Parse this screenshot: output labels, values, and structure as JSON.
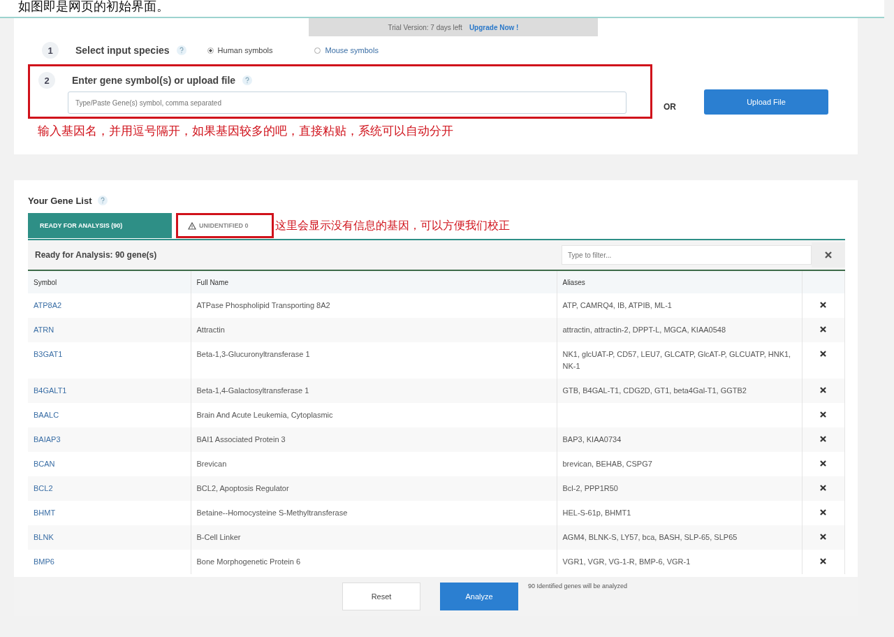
{
  "caption": "如图即是网页的初始界面。",
  "trial_banner": {
    "text": "Trial Version: 7 days left",
    "link": "Upgrade Now !"
  },
  "step1": {
    "number": "1",
    "label": "Select input species",
    "options": [
      {
        "label": "Human symbols",
        "selected": true
      },
      {
        "label": "Mouse symbols",
        "selected": false
      }
    ]
  },
  "step2": {
    "number": "2",
    "label": "Enter gene symbol(s) or upload file",
    "placeholder": "Type/Paste Gene(s) symbol, comma separated",
    "or_text": "OR",
    "upload_button": "Upload File",
    "highlighted": true,
    "annotation": "输入基因名，并用逗号隔开，如果基因较多的吧，直接粘贴，系统可以自动分开"
  },
  "gene_list": {
    "title": "Your Gene List",
    "tabs": [
      {
        "label": "READY FOR ANALYSIS (90)",
        "selected": true,
        "kind": "plain",
        "highlighted": false
      },
      {
        "label": "UNIDENTIFIED 0",
        "selected": false,
        "kind": "warning",
        "highlighted": true
      }
    ],
    "tab_annotation": "这里会显示没有信息的基因，可以方便我们校正",
    "heading": "Ready for Analysis: 90 gene(s)",
    "filter_placeholder": "Type to filter...",
    "columns": [
      "Symbol",
      "Full Name",
      "Aliases"
    ],
    "rows": [
      {
        "symbol": "ATP8A2",
        "full_name": "ATPase Phospholipid Transporting 8A2",
        "aliases": "ATP, CAMRQ4, IB, ATPIB, ML-1"
      },
      {
        "symbol": "ATRN",
        "full_name": "Attractin",
        "aliases": "attractin, attractin-2, DPPT-L, MGCA, KIAA0548"
      },
      {
        "symbol": "B3GAT1",
        "full_name": "Beta-1,3-Glucuronyltransferase 1",
        "aliases": "NK1, glcUAT-P, CD57, LEU7, GLCATP, GlcAT-P, GLCUATP, HNK1, NK-1"
      },
      {
        "symbol": "B4GALT1",
        "full_name": "Beta-1,4-Galactosyltransferase 1",
        "aliases": "GTB, B4GAL-T1, CDG2D, GT1, beta4Gal-T1, GGTB2"
      },
      {
        "symbol": "BAALC",
        "full_name": "Brain And Acute Leukemia, Cytoplasmic",
        "aliases": ""
      },
      {
        "symbol": "BAIAP3",
        "full_name": "BAI1 Associated Protein 3",
        "aliases": "BAP3, KIAA0734"
      },
      {
        "symbol": "BCAN",
        "full_name": "Brevican",
        "aliases": "brevican, BEHAB, CSPG7"
      },
      {
        "symbol": "BCL2",
        "full_name": "BCL2, Apoptosis Regulator",
        "aliases": "Bcl-2, PPP1R50"
      },
      {
        "symbol": "BHMT",
        "full_name": "Betaine--Homocysteine S-Methyltransferase",
        "aliases": "HEL-S-61p, BHMT1"
      },
      {
        "symbol": "BLNK",
        "full_name": "B-Cell Linker",
        "aliases": "AGM4, BLNK-S, LY57, bca, BASH, SLP-65, SLP65"
      },
      {
        "symbol": "BMP6",
        "full_name": "Bone Morphogenetic Protein 6",
        "aliases": "VGR1, VGR, VG-1-R, BMP-6, VGR-1"
      }
    ]
  },
  "footer": {
    "buttons": [
      {
        "label": "Reset",
        "kind": "default"
      },
      {
        "label": "Analyze",
        "kind": "primary"
      }
    ],
    "note": "90 Identified genes will be analyzed"
  }
}
